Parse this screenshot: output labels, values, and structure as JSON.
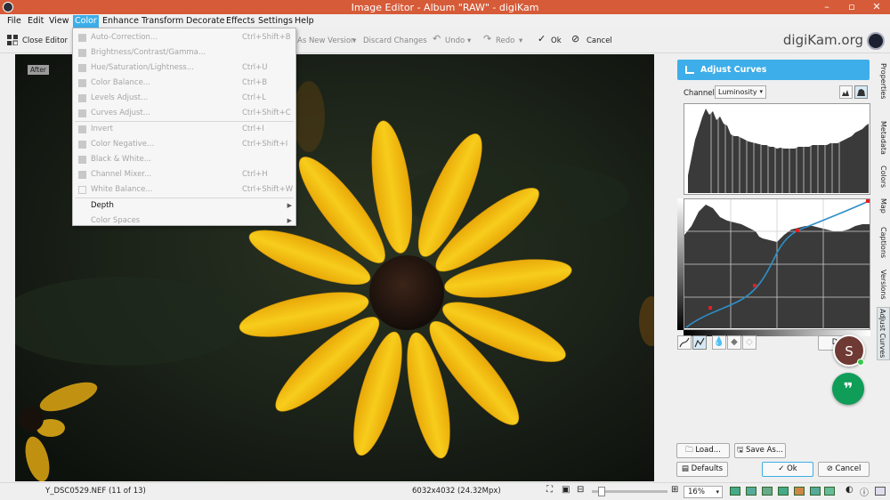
{
  "window": {
    "title": "Image Editor - Album \"RAW\" - digiKam",
    "minimize": "–",
    "maximize": "▫",
    "close": "✕"
  },
  "menu": [
    "File",
    "Edit",
    "View",
    "Color",
    "Enhance",
    "Transform",
    "Decorate",
    "Effects",
    "Settings",
    "Help"
  ],
  "toolbar": {
    "close_editor": "Close Editor",
    "as_new_version": "As New Version",
    "discard_changes": "Discard Changes",
    "undo": "Undo",
    "redo": "Redo",
    "ok": "Ok",
    "cancel": "Cancel",
    "brand": "digiKam.org"
  },
  "canvas": {
    "label": "After"
  },
  "color_menu": {
    "items": [
      {
        "label": "Auto-Correction...",
        "shortcut": "Ctrl+Shift+B"
      },
      {
        "label": "Brightness/Contrast/Gamma...",
        "shortcut": ""
      },
      {
        "label": "Hue/Saturation/Lightness...",
        "shortcut": "Ctrl+U"
      },
      {
        "label": "Color Balance...",
        "shortcut": "Ctrl+B"
      },
      {
        "label": "Levels Adjust...",
        "shortcut": "Ctrl+L"
      },
      {
        "label": "Curves Adjust...",
        "shortcut": "Ctrl+Shift+C"
      },
      {
        "label": "Invert",
        "shortcut": "Ctrl+I"
      },
      {
        "label": "Color Negative...",
        "shortcut": "Ctrl+Shift+I"
      },
      {
        "label": "Black & White...",
        "shortcut": ""
      },
      {
        "label": "Channel Mixer...",
        "shortcut": "Ctrl+H"
      },
      {
        "label": "White Balance...",
        "shortcut": "Ctrl+Shift+W"
      },
      {
        "label": "Depth",
        "shortcut": ""
      },
      {
        "label": "Color Spaces",
        "shortcut": ""
      }
    ],
    "submenu_arrow": "▶"
  },
  "panel": {
    "title": "Adjust Curves",
    "channel_label": "Channel:",
    "channel_value": "Luminosity",
    "load": "Load...",
    "save_as": "Save As...",
    "defaults": "Defaults",
    "ok": "Ok",
    "cancel": "Cancel"
  },
  "side_tabs": [
    "Properties",
    "Metadata",
    "Colors",
    "Map",
    "Captions",
    "Versions",
    "Adjust Curves"
  ],
  "status": {
    "filename": "Y_DSC0529.NEF (11 of 13)",
    "dimensions": "6032x4032 (24.32Mpx)",
    "zoom": "16%"
  },
  "overlay": {
    "avatar_letter": "S",
    "quote_glyph": "❞"
  },
  "colors": {
    "accent": "#3daee9",
    "titlebar": "#d65b39",
    "petal": "#f5c518",
    "flower_center": "#2a1a14",
    "curve": "#2f8fc8"
  }
}
